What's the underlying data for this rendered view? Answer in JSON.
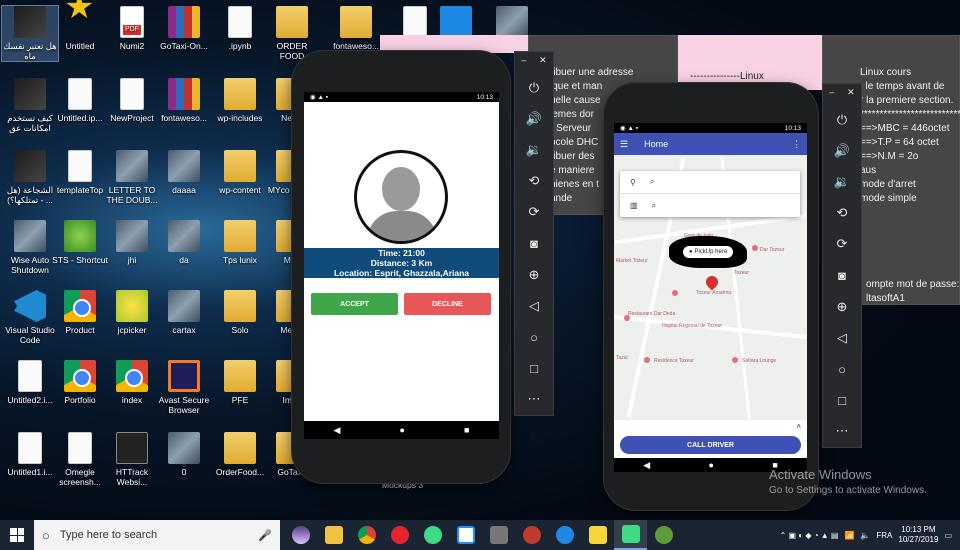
{
  "desktop": {
    "icons": [
      {
        "label": "هل تعتبر نفسك ماه",
        "kind": "video",
        "col": 0,
        "row": 0,
        "selected": true
      },
      {
        "label": "Untitled",
        "kind": "star",
        "col": 1,
        "row": 0
      },
      {
        "label": "Numi2",
        "kind": "pdf",
        "col": 2,
        "row": 0
      },
      {
        "label": "GoTaxi-On...",
        "kind": "rar",
        "col": 3,
        "row": 0
      },
      {
        "label": ".ipynb",
        "kind": "file",
        "col": 4,
        "row": 0
      },
      {
        "label": "ORDER FOOD",
        "kind": "folder",
        "col": 5,
        "row": 0
      },
      {
        "label": "كيف تستخدم امكانات عق",
        "kind": "video",
        "col": 0,
        "row": 1
      },
      {
        "label": "Untitled.ip...",
        "kind": "file",
        "col": 1,
        "row": 1
      },
      {
        "label": "NewProject",
        "kind": "file",
        "col": 2,
        "row": 1
      },
      {
        "label": "fontaweso...",
        "kind": "rar",
        "col": 3,
        "row": 1
      },
      {
        "label": "wp-includes",
        "kind": "folder",
        "col": 4,
        "row": 1
      },
      {
        "label": "New f",
        "kind": "folder",
        "col": 5,
        "row": 1
      },
      {
        "label": "الشجاعة (هل تمتلكها؟) - ...",
        "kind": "video",
        "col": 0,
        "row": 2
      },
      {
        "label": "templateTop",
        "kind": "file",
        "col": 1,
        "row": 2
      },
      {
        "label": "LETTER TO THE DOUB...",
        "kind": "photo",
        "col": 2,
        "row": 2
      },
      {
        "label": "daaaa",
        "kind": "photo",
        "col": 3,
        "row": 2
      },
      {
        "label": "wp-content",
        "kind": "folder",
        "col": 4,
        "row": 2
      },
      {
        "label": "MYco javasc",
        "kind": "folder",
        "col": 5,
        "row": 2
      },
      {
        "label": "Wise Auto Shutdown",
        "kind": "photo",
        "col": 0,
        "row": 3
      },
      {
        "label": "STS - Shortcut",
        "kind": "round-green",
        "col": 1,
        "row": 3
      },
      {
        "label": "jhi",
        "kind": "photo",
        "col": 2,
        "row": 3
      },
      {
        "label": "da",
        "kind": "photo",
        "col": 3,
        "row": 3
      },
      {
        "label": "Tps lunix",
        "kind": "folder",
        "col": 4,
        "row": 3
      },
      {
        "label": "Mon",
        "kind": "folder",
        "col": 5,
        "row": 3
      },
      {
        "label": "Visual Studio Code",
        "kind": "vscode",
        "col": 0,
        "row": 4
      },
      {
        "label": "Product",
        "kind": "chrome",
        "col": 1,
        "row": 4
      },
      {
        "label": "jcpicker",
        "kind": "cpick",
        "col": 2,
        "row": 4
      },
      {
        "label": "cartax",
        "kind": "photo",
        "col": 3,
        "row": 4
      },
      {
        "label": "Solo",
        "kind": "folder",
        "col": 4,
        "row": 4
      },
      {
        "label": "Mes p",
        "kind": "folder",
        "col": 5,
        "row": 4
      },
      {
        "label": "Untitled2.i...",
        "kind": "file",
        "col": 0,
        "row": 5
      },
      {
        "label": "Portfolio",
        "kind": "chrome",
        "col": 1,
        "row": 5
      },
      {
        "label": "index",
        "kind": "chrome",
        "col": 2,
        "row": 5
      },
      {
        "label": "Avast Secure Browser",
        "kind": "avast",
        "col": 3,
        "row": 5
      },
      {
        "label": "PFE",
        "kind": "folder",
        "col": 4,
        "row": 5
      },
      {
        "label": "Impo",
        "kind": "folder",
        "col": 5,
        "row": 5
      },
      {
        "label": "Untitled1.i...",
        "kind": "file",
        "col": 0,
        "row": 6
      },
      {
        "label": "Omegle screensh...",
        "kind": "file",
        "col": 1,
        "row": 6
      },
      {
        "label": "HTTrack Websi...",
        "kind": "httrack",
        "col": 2,
        "row": 6
      },
      {
        "label": "0",
        "kind": "photo",
        "col": 3,
        "row": 6
      },
      {
        "label": "OrderFood...",
        "kind": "folder",
        "col": 4,
        "row": 6
      },
      {
        "label": "GoTaxi-",
        "kind": "folder",
        "col": 5,
        "row": 6
      }
    ],
    "top_icons": [
      {
        "label": "fontaweso...",
        "kind": "folder"
      },
      {
        "label": "",
        "kind": "file"
      },
      {
        "label": "",
        "kind": "c"
      },
      {
        "label": "",
        "kind": "photo"
      }
    ],
    "mockups_label": "Mockups 3"
  },
  "notes": {
    "left_text": "ribuer une adresse\nique et man\nuelle cause\nlemes dor\nr Serveur\nocole DHC\nribuer des\ne maniere\nnienes en t\nande",
    "middle_text": "---------------Linux",
    "right_text": "Linux cours\n: le temps avant de\nr la premiere section.\n**************************\n==>MBC = 446octet\n==>T.P = 64 octet\n==>N.M = 2o\naus\nmode d'arret\nmode simple",
    "right_text2": "ompte mot de passe:\nltasoftA1"
  },
  "driver_phone": {
    "status_time": "10:13",
    "time_line": "Time: 21:00",
    "distance_line": "Distance: 3 Km",
    "location_line": "Location: Esprit, Ghazzala,Ariana",
    "accept_label": "ACCEPT",
    "decline_label": "DECLINE"
  },
  "rider_phone": {
    "status_time": "10:13",
    "app_title": "Home",
    "pickup_label": "PickUp here",
    "call_label": "CALL DRIVER",
    "map_labels": [
      "Gare de train",
      "Market Tozeur",
      "Dar Tozeur",
      "Tozeur",
      "Tozeur Aruahna",
      "Restaurant Dar Deda",
      "Hopital Regional de Tozeur",
      "Residence Tozeur",
      "Sahara Lounge",
      "Tazal"
    ]
  },
  "emulator_toolbar": {
    "buttons": [
      "power-icon",
      "volume-up-icon",
      "volume-down-icon",
      "rotate-left-icon",
      "rotate-right-icon",
      "camera-icon",
      "zoom-icon",
      "back-icon",
      "home-icon",
      "overview-icon",
      "more-icon"
    ]
  },
  "watermark": {
    "title": "Activate Windows",
    "subtitle": "Go to Settings to activate Windows."
  },
  "taskbar": {
    "search_placeholder": "Type here to search",
    "language": "FRA",
    "time": "10:13 PM",
    "date": "10/27/2019",
    "apps": [
      "task-view",
      "file-explorer",
      "chrome",
      "opera",
      "android-studio",
      "visual-studio",
      "vmware",
      "gimp",
      "c-app",
      "sticky-notes",
      "emulator",
      "android"
    ]
  },
  "colors": {
    "accept": "#3fa64a",
    "decline": "#e85757",
    "brand": "#3f51b5",
    "band": "#0f4b7b"
  }
}
